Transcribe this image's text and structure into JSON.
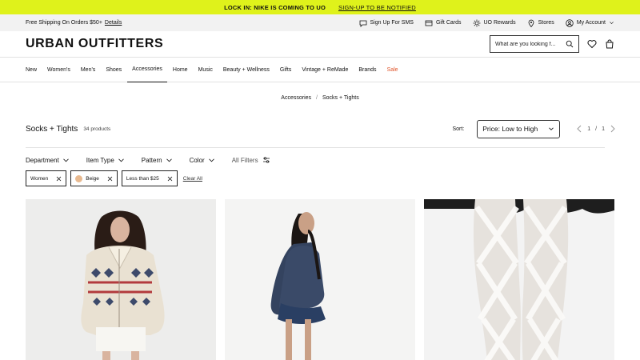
{
  "promo": {
    "text": "LOCK IN: NIKE IS COMING TO UO",
    "link": "SIGN-UP TO BE NOTIFIED"
  },
  "utility": {
    "shipping": "Free Shipping On Orders $50+",
    "details": "Details",
    "sms": "Sign Up For SMS",
    "gift_cards": "Gift Cards",
    "rewards": "UO Rewards",
    "stores": "Stores",
    "account": "My Account"
  },
  "header": {
    "logo": "URBAN OUTFITTERS",
    "search_placeholder": "What are you looking f..."
  },
  "nav": {
    "items": [
      "New",
      "Women's",
      "Men's",
      "Shoes",
      "Accessories",
      "Home",
      "Music",
      "Beauty + Wellness",
      "Gifts",
      "Vintage + ReMade",
      "Brands",
      "Sale"
    ],
    "active": "Accessories",
    "sale_color": "#e0542a"
  },
  "breadcrumb": {
    "parent": "Accessories",
    "separator": "/",
    "current": "Socks + Tights"
  },
  "listing": {
    "title": "Socks + Tights",
    "count": "34 products",
    "sort_label": "Sort:",
    "sort_value": "Price: Low to High",
    "page_current": "1",
    "page_sep": "/",
    "page_total": "1"
  },
  "filters": {
    "department": "Department",
    "item_type": "Item Type",
    "pattern": "Pattern",
    "color": "Color",
    "all": "All Filters"
  },
  "chips": {
    "women": "Women",
    "beige": "Beige",
    "price": "Less than $25",
    "clear_all": "Clear All",
    "beige_swatch": "#e8b98f"
  },
  "colors": {
    "promo_bg": "#dff21b",
    "utility_bg": "#f2f2f2"
  },
  "products": [
    {
      "image": "model-in-fair-isle-zip-cardigan"
    },
    {
      "image": "model-in-navy-sweater-and-denim-skirt"
    },
    {
      "image": "white-criss-cross-tights-legs"
    }
  ]
}
